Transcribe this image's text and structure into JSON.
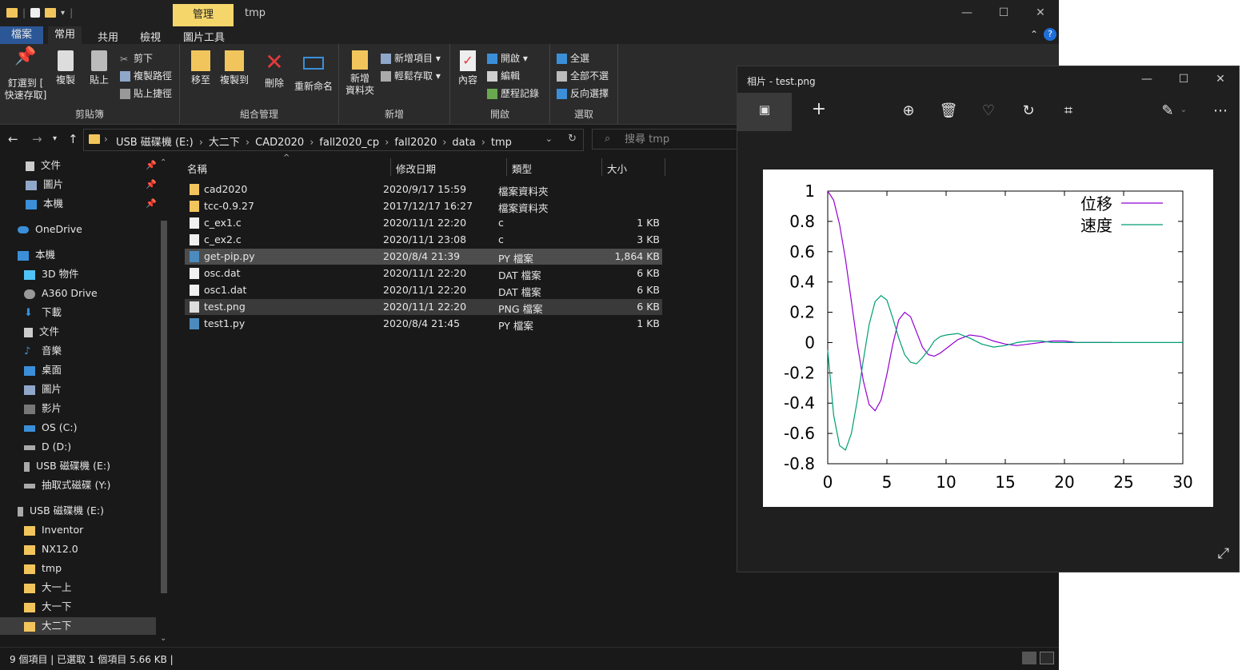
{
  "explorer": {
    "title_context_tab": "管理",
    "title": "tmp",
    "menu": {
      "file": "檔案",
      "home": "常用",
      "share": "共用",
      "view": "檢視",
      "picture_tools": "圖片工具"
    },
    "ribbon": {
      "pin_label_1": "釘選到 [",
      "pin_label_2": "快速存取]",
      "copy": "複製",
      "paste": "貼上",
      "cut": "剪下",
      "copy_path": "複製路徑",
      "paste_shortcut": "貼上捷徑",
      "clipboard_group": "剪貼簿",
      "move_to": "移至",
      "copy_to": "複製到",
      "delete": "刪除",
      "rename": "重新命名",
      "organize_group": "組合管理",
      "new_folder_1": "新增",
      "new_folder_2": "資料夾",
      "new_item": "新增項目",
      "easy_access": "輕鬆存取",
      "new_group": "新增",
      "properties": "內容",
      "open": "開啟",
      "edit": "編輯",
      "history": "歷程記錄",
      "open_group": "開啟",
      "select_all": "全選",
      "select_none": "全部不選",
      "invert_selection": "反向選擇",
      "select_group": "選取"
    },
    "breadcrumbs": [
      "USB 磁碟機 (E:)",
      "大二下",
      "CAD2020",
      "fall2020_cp",
      "fall2020",
      "data",
      "tmp"
    ],
    "search_placeholder": "搜尋 tmp",
    "nav_items": {
      "documents_q": "文件",
      "pictures_q": "圖片",
      "thispc_q": "本機",
      "onedrive": "OneDrive",
      "thispc": "本機",
      "objects3d": "3D 物件",
      "a360": "A360 Drive",
      "downloads": "下載",
      "documents": "文件",
      "music": "音樂",
      "desktop": "桌面",
      "pictures": "圖片",
      "videos": "影片",
      "osc": "OS (C:)",
      "dd": "D (D:)",
      "usbe": "USB 磁碟機 (E:)",
      "removable": "抽取式磁碟 (Y:)",
      "usbe2": "USB 磁碟機 (E:)",
      "inventor": "Inventor",
      "nx": "NX12.0",
      "tmp": "tmp",
      "y1a": "大一上",
      "y1b": "大一下",
      "y2b": "大二下"
    },
    "columns": {
      "name": "名稱",
      "modified": "修改日期",
      "type": "類型",
      "size": "大小"
    },
    "files": [
      {
        "name": "cad2020",
        "modified": "2020/9/17 15:59",
        "type": "檔案資料夾",
        "size": ""
      },
      {
        "name": "tcc-0.9.27",
        "modified": "2017/12/17 16:27",
        "type": "檔案資料夾",
        "size": ""
      },
      {
        "name": "c_ex1.c",
        "modified": "2020/11/1 22:20",
        "type": "c",
        "size": "1 KB"
      },
      {
        "name": "c_ex2.c",
        "modified": "2020/11/1 23:08",
        "type": "c",
        "size": "3 KB"
      },
      {
        "name": "get-pip.py",
        "modified": "2020/8/4 21:39",
        "type": "PY 檔案",
        "size": "1,864 KB"
      },
      {
        "name": "osc.dat",
        "modified": "2020/11/1 22:20",
        "type": "DAT 檔案",
        "size": "6 KB"
      },
      {
        "name": "osc1.dat",
        "modified": "2020/11/1 22:20",
        "type": "DAT 檔案",
        "size": "6 KB"
      },
      {
        "name": "test.png",
        "modified": "2020/11/1 22:20",
        "type": "PNG 檔案",
        "size": "6 KB"
      },
      {
        "name": "test1.py",
        "modified": "2020/8/4 21:45",
        "type": "PY 檔案",
        "size": "1 KB"
      }
    ],
    "status": "9 個項目  |  已選取 1 個項目  5.66 KB  |"
  },
  "photos": {
    "title": "相片 - test.png"
  },
  "chart_data": {
    "type": "line",
    "xlim": [
      0,
      30
    ],
    "ylim": [
      -0.8,
      1
    ],
    "xticks": [
      "0",
      "5",
      "10",
      "15",
      "20",
      "25",
      "30"
    ],
    "yticks": [
      "1",
      "0.8",
      "0.6",
      "0.4",
      "0.2",
      "0",
      "-0.2",
      "-0.4",
      "-0.6",
      "-0.8"
    ],
    "legend_position": "top-right",
    "series": [
      {
        "name": "位移",
        "color": "#9400d3",
        "x": [
          0,
          0.5,
          1,
          1.5,
          2,
          2.5,
          3,
          3.5,
          4,
          4.5,
          5,
          5.5,
          6,
          6.5,
          7,
          7.5,
          8,
          8.5,
          9,
          9.5,
          10,
          11,
          12,
          13,
          14,
          15,
          16,
          17,
          18,
          19,
          20,
          21,
          22,
          23,
          24
        ],
        "y": [
          1,
          0.94,
          0.78,
          0.55,
          0.27,
          -0.01,
          -0.25,
          -0.41,
          -0.45,
          -0.38,
          -0.21,
          -0.01,
          0.15,
          0.2,
          0.17,
          0.07,
          -0.03,
          -0.08,
          -0.09,
          -0.07,
          -0.04,
          0.02,
          0.05,
          0.04,
          0.01,
          -0.01,
          -0.02,
          -0.01,
          0,
          0.01,
          0.01,
          0,
          0,
          0,
          0
        ]
      },
      {
        "name": "速度",
        "color": "#009e73",
        "x": [
          0,
          0.5,
          1,
          1.5,
          2,
          2.5,
          3,
          3.5,
          4,
          4.5,
          5,
          5.5,
          6,
          6.5,
          7,
          7.5,
          8,
          8.5,
          9,
          9.5,
          10,
          11,
          12,
          13,
          14,
          15,
          16,
          17,
          18,
          19,
          20,
          21,
          22,
          23,
          24,
          25,
          26,
          27,
          28,
          29,
          30
        ],
        "y": [
          -0.05,
          -0.48,
          -0.68,
          -0.71,
          -0.6,
          -0.38,
          -0.12,
          0.12,
          0.27,
          0.31,
          0.28,
          0.16,
          0.03,
          -0.08,
          -0.13,
          -0.14,
          -0.1,
          -0.05,
          0.01,
          0.04,
          0.05,
          0.06,
          0.03,
          -0.01,
          -0.03,
          -0.02,
          0,
          0.01,
          0.01,
          0,
          0,
          0,
          0,
          0,
          0,
          0,
          0,
          0,
          0,
          0,
          0
        ]
      }
    ]
  }
}
